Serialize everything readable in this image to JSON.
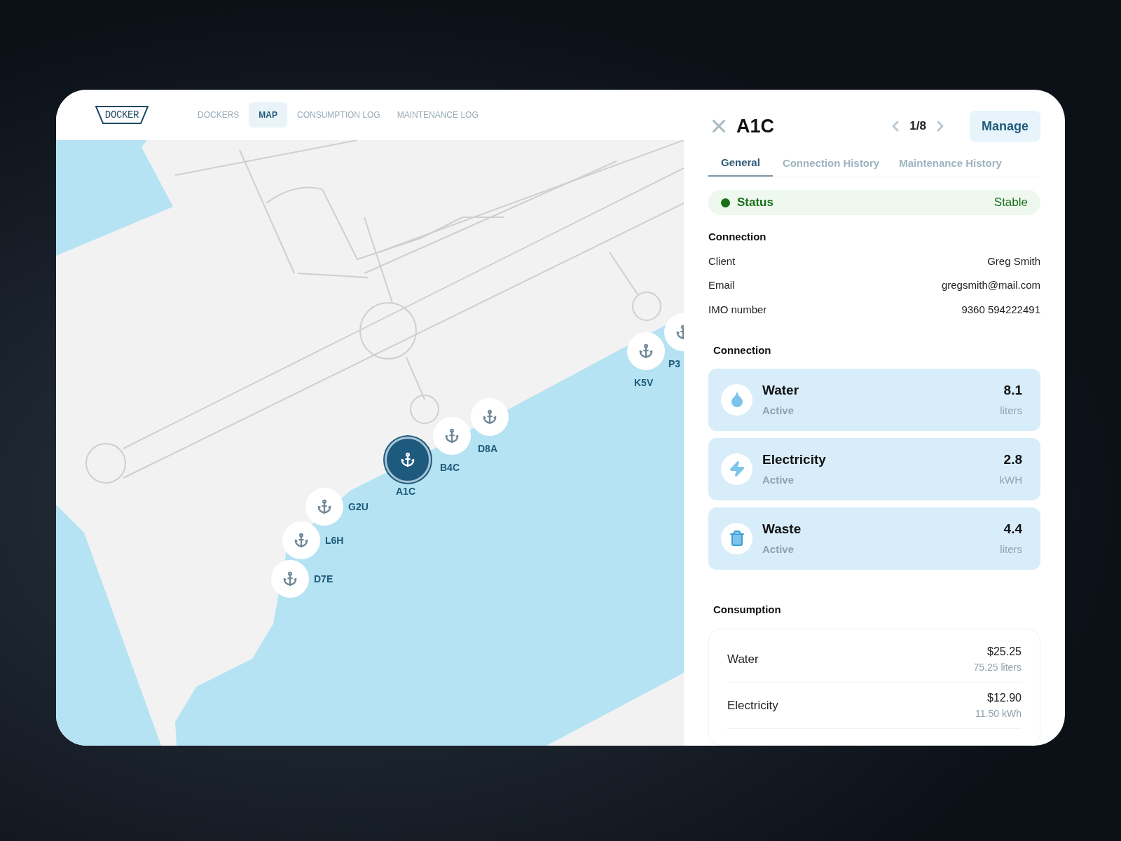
{
  "nav": {
    "logo": "DOCKER",
    "tabs": [
      {
        "label": "DOCKERS",
        "selected": false
      },
      {
        "label": "MAP",
        "selected": true
      },
      {
        "label": "CONSUMPTION LOG",
        "selected": false
      },
      {
        "label": "MAINTENANCE LOG",
        "selected": false
      }
    ]
  },
  "map": {
    "markers": [
      {
        "label": "K5V",
        "selected": false
      },
      {
        "label": "P3",
        "selected": false
      },
      {
        "label": "D8A",
        "selected": false
      },
      {
        "label": "B4C",
        "selected": false
      },
      {
        "label": "A1C",
        "selected": true
      },
      {
        "label": "G2U",
        "selected": false
      },
      {
        "label": "L6H",
        "selected": false
      },
      {
        "label": "D7E",
        "selected": false
      }
    ]
  },
  "panel": {
    "title": "A1C",
    "pager": "1/8",
    "manage": "Manage",
    "tabs": [
      {
        "label": "General",
        "selected": true
      },
      {
        "label": "Connection History",
        "selected": false
      },
      {
        "label": "Maintenance History",
        "selected": false
      }
    ],
    "status": {
      "label": "Status",
      "value": "Stable"
    },
    "connection": {
      "heading": "Connection",
      "rows": [
        {
          "label": "Client",
          "value": "Greg Smith"
        },
        {
          "label": "Email",
          "value": "gregsmith@mail.com"
        },
        {
          "label": "IMO number",
          "value": "9360 594222491"
        }
      ]
    },
    "services": {
      "heading": "Connection",
      "items": [
        {
          "kind": "water",
          "name": "Water",
          "status": "Active",
          "value": "8.1",
          "unit": "liters"
        },
        {
          "kind": "electricity",
          "name": "Electricity",
          "status": "Active",
          "value": "2.8",
          "unit": "kWH"
        },
        {
          "kind": "waste",
          "name": "Waste",
          "status": "Active",
          "value": "4.4",
          "unit": "liters"
        }
      ]
    },
    "consumption": {
      "heading": "Consumption",
      "rows": [
        {
          "name": "Water",
          "cost": "$25.25",
          "amount": "75.25 liters"
        },
        {
          "name": "Electricity",
          "cost": "$12.90",
          "amount": "11.50 kWh"
        }
      ]
    }
  }
}
